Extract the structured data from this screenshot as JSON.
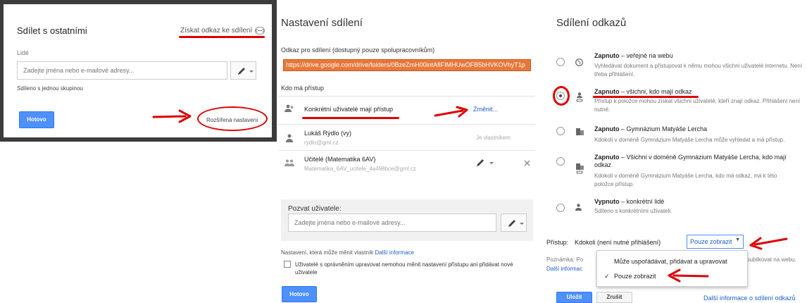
{
  "panel1": {
    "title": "Sdílet s ostatními",
    "get_link": "Získat odkaz ke sdílení",
    "people_label": "Lidé",
    "people_placeholder": "Zadejte jména nebo e-mailové adresy...",
    "shared_note": "Sdíleno s jednou skupinou",
    "done": "Hotovo",
    "advanced": "Rozšířená nastavení"
  },
  "panel2": {
    "title": "Nastavení sdílení",
    "link_label": "Odkaz pro sdílení (dostupný pouze spolupracovníkům)",
    "link_value": "https://drive.google.com/drive/folders/0BzeZmH00intAfiFIMHUwOFB5bHVKOVhyT1p",
    "who_label": "Kdo má přístup",
    "access_text": "Konkrétní uživatelé mají přístup",
    "change": "Změnit...",
    "users": [
      {
        "name": "Lukáš Rýdlo (vy)",
        "email": "rydlo@gml.cz",
        "role": "Je vlastníkem"
      },
      {
        "name": "Učitelé (Matematika 6AV)",
        "email": "Matematika_6AV_ucitele_4a498bce@gml.cz"
      }
    ],
    "invite_label": "Pozvat uživatele:",
    "invite_placeholder": "Zadejte jména nebo e-mailové adresy...",
    "owner_settings": "Nastavení, která může měnit vlastník",
    "more_info": "Další informace",
    "checkbox_label": "Uživatelé s oprávněním upravovat nemohou měnit nastavení přístupu ani přidávat nové uživatele",
    "done": "Hotovo"
  },
  "panel3": {
    "title": "Sdílení odkazů",
    "options": [
      {
        "bold": "Zapnuto",
        "rest": " – veřejné na webu",
        "desc": "Vyhledávat dokument a přistupovat k němu mohou všichni uživatelé internetu. Není třeba přihlášení.",
        "icon": "globe-icon"
      },
      {
        "bold": "Zapnuto",
        "rest": " – všichni, kdo mají odkaz",
        "desc": "Přístup k položce mohou získat všichni uživatelé, kteří znají odkaz. Přihlášení není nutné.",
        "icon": "person-link-icon"
      },
      {
        "bold": "Zapnuto",
        "rest": " – Gymnázium Matyáše Lercha",
        "desc": "Kdokoli v doméně Gymnázium Matyáše Lercha může vyhledat a má přístup.",
        "icon": "building-icon"
      },
      {
        "bold": "Zapnuto",
        "rest": " – Všichni v doméně Gymnázium Matyáše Lercha, kdo mají odkaz",
        "desc": "Kdokoli v doméně Gymnázium Matyáše Lercha, kdo má odkaz, má k této položce přístup.",
        "icon": "building-link-icon"
      },
      {
        "bold": "Vypnuto",
        "rest": " – konkrétní lidé",
        "desc": "Sdíleno s konkrétními uživateli.",
        "icon": "person-icon"
      }
    ],
    "selected_index": 1,
    "access_label": "Přístup:",
    "access_value": "Kdokoli (není nutné přihlášení)",
    "dropdown_value": "Pouze zobrazit",
    "note_label": "Poznámka: Po",
    "note_tail": "publikovat na webu.",
    "more_info_short": "Další informac",
    "menu_items": [
      "Může uspořádávat, přidávat a upravovat",
      "Pouze zobrazit"
    ],
    "menu_checked_index": 1,
    "save": "Uložit",
    "cancel": "Zrušit",
    "more_info_link": "Další informace o sdílení odkazů"
  }
}
